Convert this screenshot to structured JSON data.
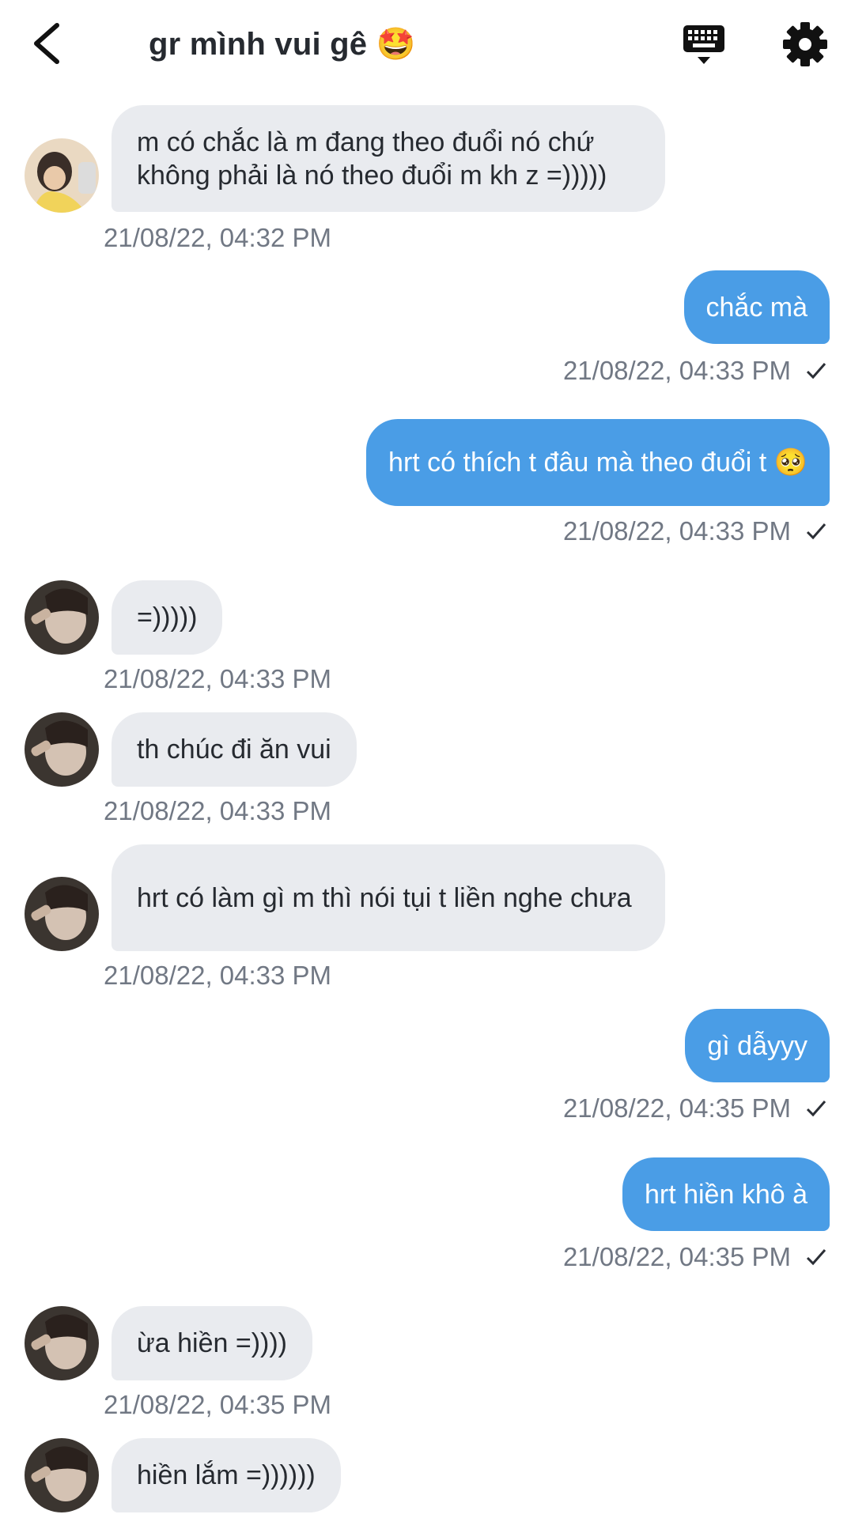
{
  "header": {
    "title": "gr mình vui gê",
    "title_emoji": "🤩"
  },
  "messages": [
    {
      "dir": "in",
      "text": "m có chắc là m đang theo đuổi nó chứ không phải là nó theo đuổi m kh z =)))))",
      "time": "21/08/22, 04:32 PM"
    },
    {
      "dir": "out",
      "text": "chắc mà",
      "time": "21/08/22, 04:33 PM"
    },
    {
      "dir": "out",
      "text": "hrt có thích t đâu mà theo đuổi t 🥺",
      "time": "21/08/22, 04:33 PM"
    },
    {
      "dir": "in",
      "text": "=)))))",
      "time": "21/08/22, 04:33 PM"
    },
    {
      "dir": "in",
      "text": "th chúc đi ăn vui",
      "time": "21/08/22, 04:33 PM"
    },
    {
      "dir": "in",
      "text": "hrt có làm gì m thì nói tụi t liền nghe chưa",
      "time": "21/08/22, 04:33 PM"
    },
    {
      "dir": "out",
      "text": "gì dẫyyy",
      "time": "21/08/22, 04:35 PM"
    },
    {
      "dir": "out",
      "text": "hrt hiền khô à",
      "time": "21/08/22, 04:35 PM"
    },
    {
      "dir": "in",
      "text": "ừa hiền =))))",
      "time": "21/08/22, 04:35 PM"
    },
    {
      "dir": "in",
      "text": "hiền lắm =))))))",
      "time": ""
    }
  ],
  "colors": {
    "outgoing_bubble": "#4a9de6",
    "incoming_bubble": "#e9ebef",
    "timestamp": "#717884"
  },
  "icons": {
    "back": "chevron-left-icon",
    "keyboard": "keyboard-icon",
    "settings": "gear-icon",
    "read": "checkmark-icon"
  }
}
